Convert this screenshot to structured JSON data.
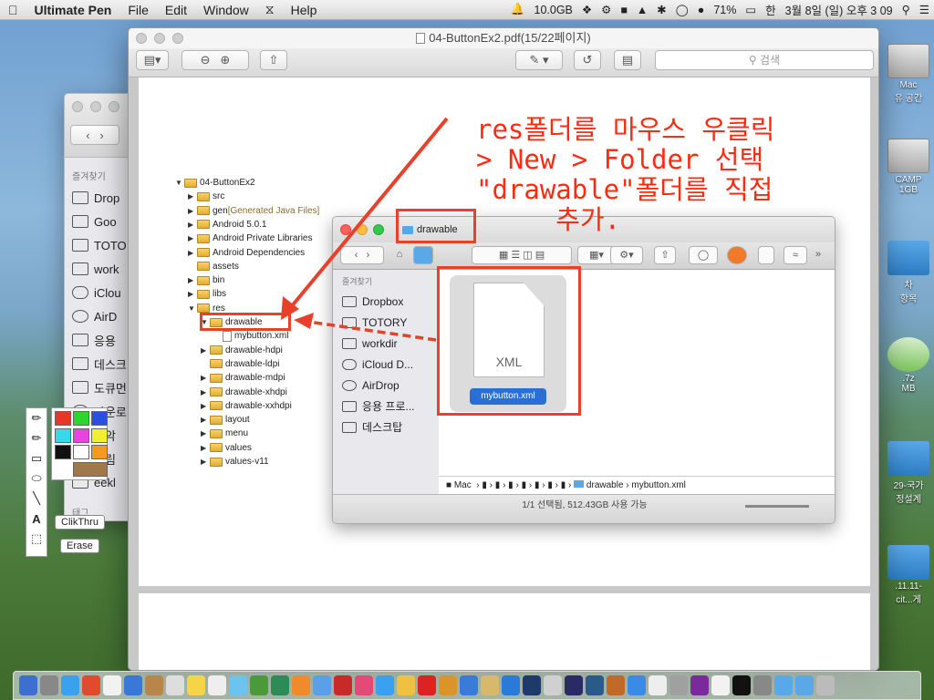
{
  "menubar": {
    "app": "Ultimate Pen",
    "items": [
      "File",
      "Edit",
      "Window",
      "Help"
    ],
    "disk": "10.0GB",
    "battery": "71%",
    "input": "한",
    "clock": "3월 8일 (일) 오후  3 09"
  },
  "desktop": {
    "icons": [
      {
        "label": "Mac",
        "sub": "유 공간"
      },
      {
        "label": "CAMP",
        "sub": "1GB"
      },
      {
        "label": "차",
        "sub": "항목"
      },
      {
        "label": ".7z",
        "sub": "MB"
      },
      {
        "label": "29-국가",
        "sub": "정설계"
      },
      {
        "label": ".11.11-",
        "sub": "cit...게"
      }
    ]
  },
  "bg_finder": {
    "favorites_header": "즐겨찾기",
    "items": [
      "Drop",
      "Goo",
      "TOTO",
      "work",
      "iClou",
      "AirD",
      "응용",
      "데스크",
      "도큐먼",
      "다운로",
      "음악",
      "그림",
      "eekl"
    ],
    "tags_header": "태그"
  },
  "preview": {
    "title": "04-ButtonEx2.pdf(15/22페이지)",
    "search_placeholder": "검색",
    "annotation": "res폴더를 마우스 우클릭\n> New > Folder 선택\n\"drawable\"폴더를 직접\n     추가.",
    "tree": [
      {
        "label": "04-ButtonEx2",
        "depth": 0,
        "arrow": "▼"
      },
      {
        "label": "src",
        "depth": 1,
        "arrow": "▶"
      },
      {
        "label": "gen",
        "suffix": "[Generated Java Files]",
        "depth": 1,
        "arrow": "▶"
      },
      {
        "label": "Android 5.0.1",
        "depth": 1,
        "arrow": "▶"
      },
      {
        "label": "Android Private Libraries",
        "depth": 1,
        "arrow": "▶"
      },
      {
        "label": "Android Dependencies",
        "depth": 1,
        "arrow": "▶"
      },
      {
        "label": "assets",
        "depth": 1,
        "arrow": ""
      },
      {
        "label": "bin",
        "depth": 1,
        "arrow": "▶"
      },
      {
        "label": "libs",
        "depth": 1,
        "arrow": "▶"
      },
      {
        "label": "res",
        "depth": 1,
        "arrow": "▼"
      },
      {
        "label": "drawable",
        "depth": 2,
        "arrow": "▼"
      },
      {
        "label": "mybutton.xml",
        "depth": 3,
        "arrow": ""
      },
      {
        "label": "drawable-hdpi",
        "depth": 2,
        "arrow": "▶"
      },
      {
        "label": "drawable-ldpi",
        "depth": 2,
        "arrow": ""
      },
      {
        "label": "drawable-mdpi",
        "depth": 2,
        "arrow": "▶"
      },
      {
        "label": "drawable-xhdpi",
        "depth": 2,
        "arrow": "▶"
      },
      {
        "label": "drawable-xxhdpi",
        "depth": 2,
        "arrow": "▶"
      },
      {
        "label": "layout",
        "depth": 2,
        "arrow": "▶"
      },
      {
        "label": "menu",
        "depth": 2,
        "arrow": "▶"
      },
      {
        "label": "values",
        "depth": 2,
        "arrow": "▶"
      },
      {
        "label": "values-v11",
        "depth": 2,
        "arrow": "▶"
      }
    ],
    "finder": {
      "folder": "drawable",
      "favorites_header": "즐겨찾기",
      "sidebar": [
        "Dropbox",
        "TOTORY",
        "workdir",
        "iCloud D...",
        "AirDrop",
        "응용 프로...",
        "데스크탑"
      ],
      "file_name": "mybutton.xml",
      "file_type": "XML",
      "path": [
        "Mac",
        "drawable",
        "mybutton.xml"
      ],
      "status": "1/1 선택됨, 512.43GB 사용 가능"
    }
  },
  "ink": {
    "clickthru": "ClikThru",
    "erase": "Erase",
    "swatches": [
      "#e8362a",
      "#2fd52f",
      "#2a4fe0",
      "#36d9e8",
      "#e844e0",
      "#f0f030",
      "#111111",
      "#ffffff",
      "#f59a20",
      "#a0784a"
    ]
  },
  "colors": {
    "annotation": "#ff2a10",
    "highlight": "#e8402a",
    "selection": "#2a6fd6"
  }
}
